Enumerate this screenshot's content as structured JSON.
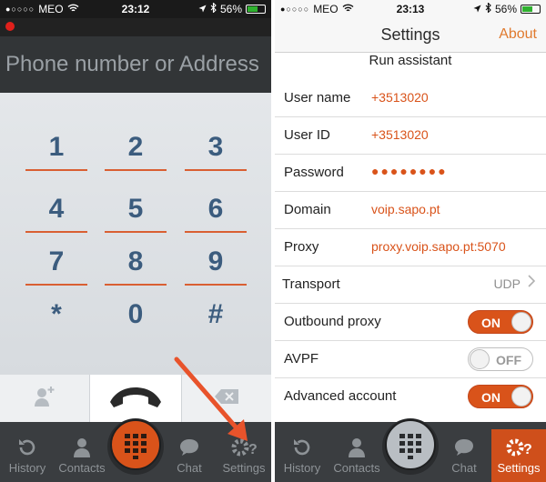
{
  "colors": {
    "accent": "#d9531a",
    "keypad_text": "#3b5c7e",
    "arrow": "#e8532b"
  },
  "left": {
    "status": {
      "carrier": "MEO",
      "time": "23:12",
      "battery": "56%"
    },
    "address_placeholder": "Phone number or Address",
    "keys": [
      "1",
      "2",
      "3",
      "4",
      "5",
      "6",
      "7",
      "8",
      "9",
      "*",
      "0",
      "#"
    ],
    "tabs": [
      {
        "label": "History",
        "icon": "history-icon"
      },
      {
        "label": "Contacts",
        "icon": "contacts-icon"
      },
      {
        "label": "Chat",
        "icon": "chat-icon"
      },
      {
        "label": "Settings",
        "icon": "settings-icon"
      }
    ]
  },
  "right": {
    "status": {
      "carrier": "MEO",
      "time": "23:13",
      "battery": "56%"
    },
    "nav": {
      "title": "Settings",
      "action": "About"
    },
    "run_assistant": "Run assistant",
    "rows": {
      "username": {
        "label": "User name",
        "value": "+3513020"
      },
      "userid": {
        "label": "User ID",
        "value": "+3513020"
      },
      "password": {
        "label": "Password",
        "value": "●●●●●●●●"
      },
      "domain": {
        "label": "Domain",
        "value": "voip.sapo.pt"
      },
      "proxy": {
        "label": "Proxy",
        "value": "proxy.voip.sapo.pt:5070"
      },
      "transport": {
        "label": "Transport",
        "value": "UDP"
      },
      "outbound": {
        "label": "Outbound proxy",
        "state": "ON"
      },
      "avpf": {
        "label": "AVPF",
        "state": "OFF"
      },
      "advanced": {
        "label": "Advanced account",
        "state": "ON"
      }
    },
    "tabs": [
      {
        "label": "History",
        "icon": "history-icon"
      },
      {
        "label": "Contacts",
        "icon": "contacts-icon"
      },
      {
        "label": "Chat",
        "icon": "chat-icon"
      },
      {
        "label": "Settings",
        "icon": "settings-icon"
      }
    ]
  }
}
